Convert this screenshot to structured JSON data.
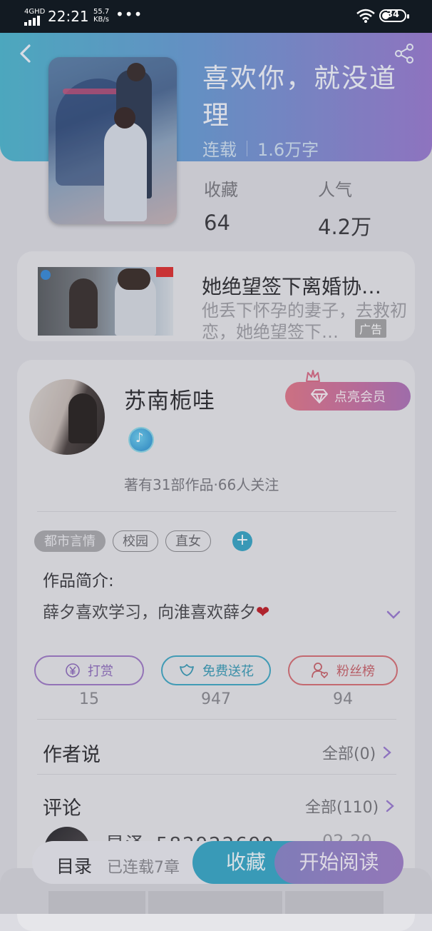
{
  "status_bar": {
    "network": "4GHD",
    "time": "22:21",
    "speed_value": "55.7",
    "speed_unit": "KB/s",
    "more_dots": "•••",
    "battery": "34"
  },
  "book": {
    "title": "喜欢你，就没道理",
    "status": "连载",
    "word_count": "1.6万字",
    "stats": [
      {
        "label": "收藏",
        "value": "64"
      },
      {
        "label": "人气",
        "value": "4.2万"
      }
    ]
  },
  "ad": {
    "title": "她绝望签下离婚协…",
    "description": "他丢下怀孕的妻子，去救初恋，她绝望签下…",
    "tag": "广告"
  },
  "author": {
    "name": "苏南栀哇",
    "vip_label": "点亮会员",
    "stats_text": "著有31部作品·66人关注"
  },
  "tags": [
    "都市言情",
    "校园",
    "直女"
  ],
  "tag_add": "+",
  "intro": {
    "label": "作品简介:",
    "text": "薛夕喜欢学习，向淮喜欢薛夕",
    "heart": "❤"
  },
  "actions": [
    {
      "label": "打赏",
      "count": "15",
      "icon": "yen-icon"
    },
    {
      "label": "免费送花",
      "count": "947",
      "icon": "flower-icon"
    },
    {
      "label": "粉丝榜",
      "count": "94",
      "icon": "fan-icon"
    }
  ],
  "author_says": {
    "title": "作者说",
    "more": "全部(0)"
  },
  "comments": {
    "title": "评论",
    "more": "全部(110)",
    "first_user": "星泽_582922699",
    "first_date": "02-20"
  },
  "bottom_bar": {
    "toc": "目录",
    "serial_info": "已连载7章",
    "collect": "收藏",
    "read": "开始阅读"
  },
  "colors": {
    "header_start": "#4fb7cf",
    "header_end": "#9a7cd0",
    "accent_teal": "#3aa8c6",
    "accent_purple": "#9f80c8"
  }
}
